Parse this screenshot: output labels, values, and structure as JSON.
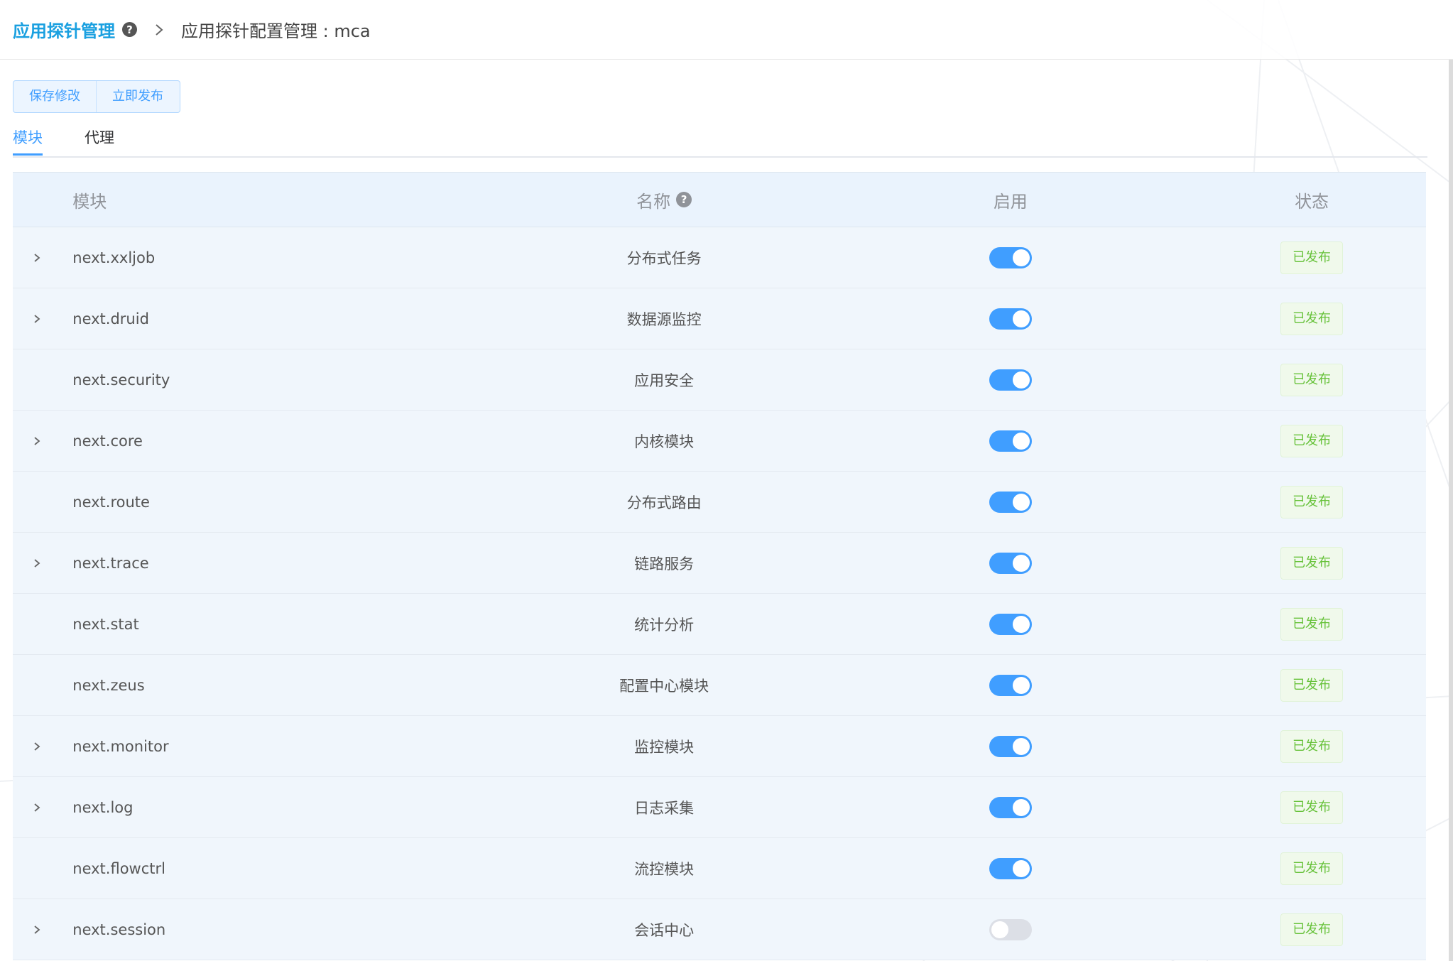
{
  "breadcrumb": {
    "root": "应用探针管理",
    "current": "应用探针配置管理 : mca"
  },
  "toolbar": {
    "save_label": "保存修改",
    "publish_label": "立即发布"
  },
  "tabs": [
    {
      "label": "模块",
      "active": true
    },
    {
      "label": "代理",
      "active": false
    }
  ],
  "table": {
    "columns": {
      "module": "模块",
      "name": "名称",
      "enabled": "启用",
      "status": "状态"
    },
    "rows": [
      {
        "module": "next.xxljob",
        "name": "分布式任务",
        "enabled": true,
        "expandable": true,
        "status": "已发布"
      },
      {
        "module": "next.druid",
        "name": "数据源监控",
        "enabled": true,
        "expandable": true,
        "status": "已发布"
      },
      {
        "module": "next.security",
        "name": "应用安全",
        "enabled": true,
        "expandable": false,
        "status": "已发布"
      },
      {
        "module": "next.core",
        "name": "内核模块",
        "enabled": true,
        "expandable": true,
        "status": "已发布"
      },
      {
        "module": "next.route",
        "name": "分布式路由",
        "enabled": true,
        "expandable": false,
        "status": "已发布"
      },
      {
        "module": "next.trace",
        "name": "链路服务",
        "enabled": true,
        "expandable": true,
        "status": "已发布"
      },
      {
        "module": "next.stat",
        "name": "统计分析",
        "enabled": true,
        "expandable": false,
        "status": "已发布"
      },
      {
        "module": "next.zeus",
        "name": "配置中心模块",
        "enabled": true,
        "expandable": false,
        "status": "已发布"
      },
      {
        "module": "next.monitor",
        "name": "监控模块",
        "enabled": true,
        "expandable": true,
        "status": "已发布"
      },
      {
        "module": "next.log",
        "name": "日志采集",
        "enabled": true,
        "expandable": true,
        "status": "已发布"
      },
      {
        "module": "next.flowctrl",
        "name": "流控模块",
        "enabled": true,
        "expandable": false,
        "status": "已发布"
      },
      {
        "module": "next.session",
        "name": "会话中心",
        "enabled": false,
        "expandable": true,
        "status": "已发布"
      }
    ]
  },
  "colors": {
    "accent": "#409eff",
    "breadcrumb_root": "#1aa0e0",
    "published_tag": "#67c23a",
    "switch_off": "#dcdfe6"
  }
}
